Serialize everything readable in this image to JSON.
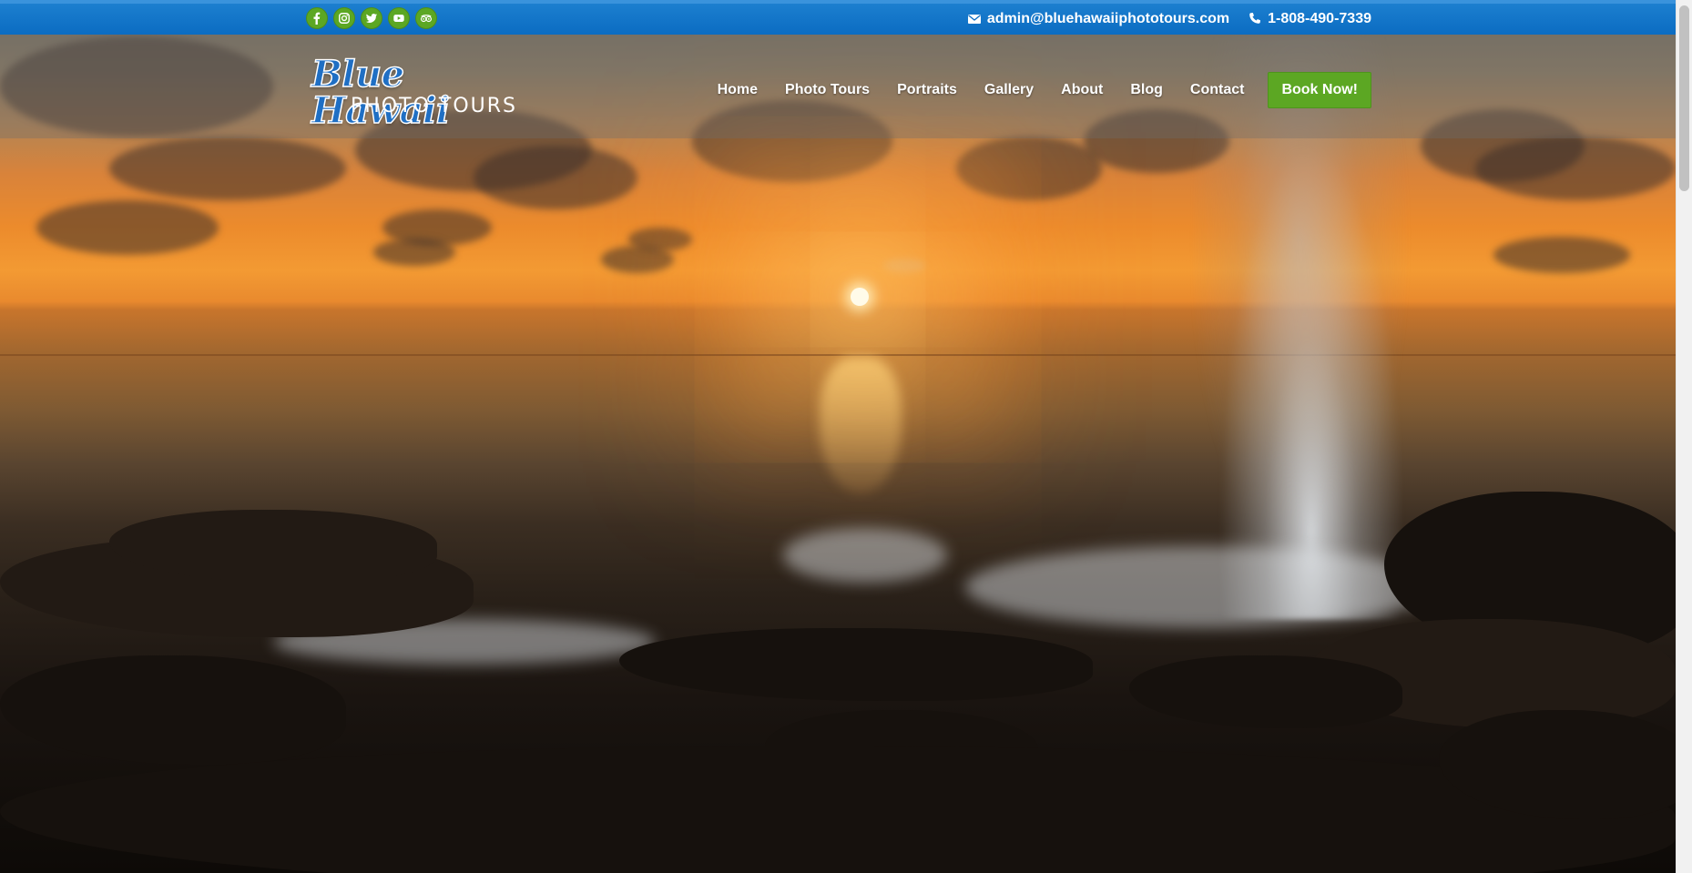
{
  "topbar": {
    "socials": [
      {
        "name": "facebook",
        "icon": "facebook-icon"
      },
      {
        "name": "instagram",
        "icon": "instagram-icon"
      },
      {
        "name": "twitter",
        "icon": "twitter-icon"
      },
      {
        "name": "youtube",
        "icon": "youtube-icon"
      },
      {
        "name": "tripadvisor",
        "icon": "tripadvisor-icon"
      }
    ],
    "email": "admin@bluehawaiiphototours.com",
    "phone": "1-808-490-7339"
  },
  "logo": {
    "script": "Blue Hawaii",
    "subtitle": "PHOTO TOURS"
  },
  "nav": {
    "items": [
      "Home",
      "Photo Tours",
      "Portraits",
      "Gallery",
      "About",
      "Blog",
      "Contact"
    ],
    "cta": "Book Now!"
  },
  "colors": {
    "topbar": "#0b6cc2",
    "accent_green": "#5ca723",
    "logo_blue": "#1f6fc4"
  }
}
